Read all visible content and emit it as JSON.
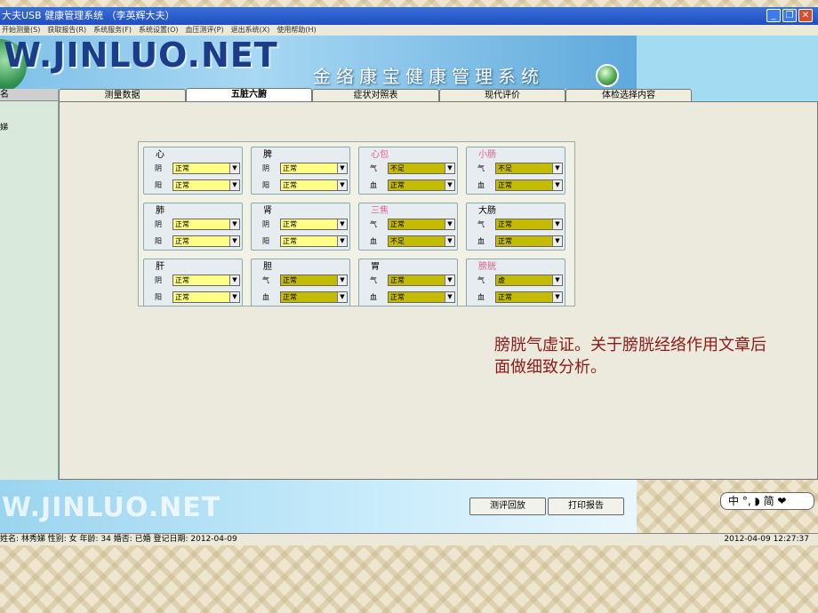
{
  "window": {
    "title": "大夫USB 健康管理系统 （李英辉大夫）",
    "min": "_",
    "max": "❐",
    "close": "✕"
  },
  "menu": [
    "开始测量(S)",
    "获取报告(R)",
    "系统服务(F)",
    "系统设置(O)",
    "血压测评(P)",
    "退出系统(X)",
    "使用帮助(H)"
  ],
  "banner": {
    "logo": "W.JINLUO.NET",
    "system_name": "金络康宝健康管理系统"
  },
  "left_panel": {
    "header": "名",
    "item": "娣"
  },
  "tabs": [
    "测量数据",
    "五脏六腑",
    "症状对照表",
    "现代评价",
    "体检选择内容"
  ],
  "organs": [
    {
      "name": "心",
      "pink": false,
      "rows": [
        {
          "label": "阴",
          "value": "正常",
          "olive": false
        },
        {
          "label": "阳",
          "value": "正常",
          "olive": false
        }
      ]
    },
    {
      "name": "脾",
      "pink": false,
      "rows": [
        {
          "label": "阴",
          "value": "正常",
          "olive": false
        },
        {
          "label": "阳",
          "value": "正常",
          "olive": false
        }
      ]
    },
    {
      "name": "心包",
      "pink": true,
      "rows": [
        {
          "label": "气",
          "value": "不足",
          "olive": true
        },
        {
          "label": "血",
          "value": "正常",
          "olive": true
        }
      ]
    },
    {
      "name": "小肠",
      "pink": true,
      "rows": [
        {
          "label": "气",
          "value": "不足",
          "olive": true
        },
        {
          "label": "血",
          "value": "正常",
          "olive": true
        }
      ]
    },
    {
      "name": "肺",
      "pink": false,
      "rows": [
        {
          "label": "阴",
          "value": "正常",
          "olive": false
        },
        {
          "label": "阳",
          "value": "正常",
          "olive": false
        }
      ]
    },
    {
      "name": "肾",
      "pink": false,
      "rows": [
        {
          "label": "阴",
          "value": "正常",
          "olive": false
        },
        {
          "label": "阳",
          "value": "正常",
          "olive": false
        }
      ]
    },
    {
      "name": "三焦",
      "pink": true,
      "rows": [
        {
          "label": "气",
          "value": "正常",
          "olive": true
        },
        {
          "label": "血",
          "value": "不足",
          "olive": true
        }
      ]
    },
    {
      "name": "大肠",
      "pink": false,
      "rows": [
        {
          "label": "气",
          "value": "正常",
          "olive": true
        },
        {
          "label": "血",
          "value": "正常",
          "olive": true
        }
      ]
    },
    {
      "name": "肝",
      "pink": false,
      "rows": [
        {
          "label": "阴",
          "value": "正常",
          "olive": false
        },
        {
          "label": "阳",
          "value": "正常",
          "olive": false
        }
      ]
    },
    {
      "name": "胆",
      "pink": false,
      "rows": [
        {
          "label": "气",
          "value": "正常",
          "olive": true
        },
        {
          "label": "血",
          "value": "正常",
          "olive": true
        }
      ]
    },
    {
      "name": "胃",
      "pink": false,
      "rows": [
        {
          "label": "气",
          "value": "正常",
          "olive": true
        },
        {
          "label": "血",
          "value": "正常",
          "olive": true
        }
      ]
    },
    {
      "name": "膀胱",
      "pink": true,
      "rows": [
        {
          "label": "气",
          "value": "虚",
          "olive": true
        },
        {
          "label": "血",
          "value": "正常",
          "olive": true
        }
      ]
    }
  ],
  "annotation": "膀胱气虚证。关于膀胱经络作用文章后面做细致分析。",
  "bottom": {
    "logo": "W.JINLUO.NET",
    "replay_button": "测评回放",
    "print_button": "打印报告"
  },
  "ime": "中 °, ◗ 简 ❤",
  "status": {
    "left": "姓名: 林秀娣  性别: 女  年龄: 34  婚否: 已婚  登记日期: 2012-04-09",
    "right": "2012-04-09 12:27:37"
  },
  "colors": {
    "dropdown_yellow": "#ffff88",
    "dropdown_olive": "#c4bb05",
    "annotation": "#8b1a1a",
    "pink_label": "#e0608a"
  }
}
